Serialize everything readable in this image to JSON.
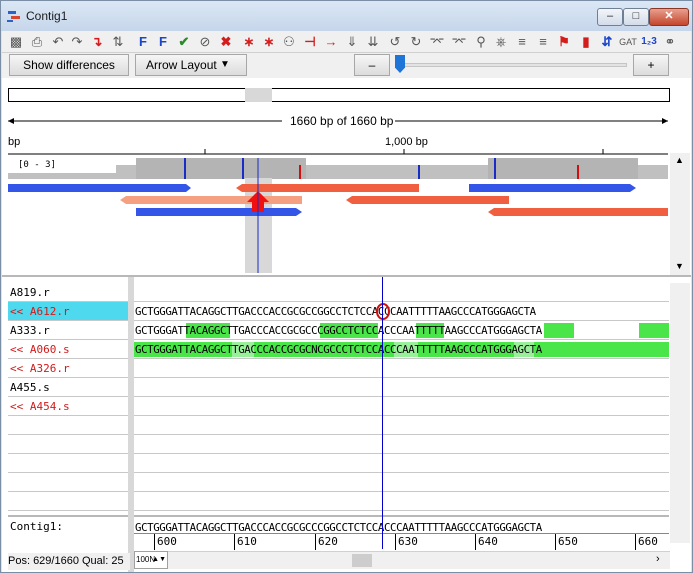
{
  "window": {
    "title": "Contig1",
    "minimize": "–",
    "maximize": "□",
    "close": "✕"
  },
  "toolbar": {
    "icons": [
      "save-icon",
      "print-icon",
      "undo-icon",
      "redo-icon",
      "tools-icon",
      "swap-icon",
      "find-forward-icon",
      "find-reverse-icon",
      "accept-icon",
      "reject-icon",
      "delete-marks-icon",
      "next-mark-icon",
      "prev-mark-icon",
      "binoculars-icon",
      "cut-icon",
      "arrow-icon",
      "down-icon",
      "down2-icon",
      "curve-left-icon",
      "curve-right-icon",
      "hat-icon",
      "hat2-icon",
      "zoom-icon",
      "tree-icon",
      "lines-icon",
      "lines2-icon",
      "flag-icon",
      "chromatogram-icon",
      "exchange-icon",
      "gat-icon",
      "number-icon",
      "link-icon"
    ]
  },
  "controls": {
    "show_differences": "Show differences",
    "arrow_layout": "Arrow Layout",
    "dropdown_glyph": "▼",
    "minus": "–",
    "plus": "+",
    "slider_fraction": 0.0
  },
  "overview": {
    "span_label": "1660 bp of 1660 bp",
    "left_tick": "bp",
    "mid_tick": "1,000 bp",
    "depth_label": "[0 - 3]",
    "colors": {
      "forward": "#3355e8",
      "reverse": "#f06040",
      "reverse_light": "#f5a080",
      "coverage": "#c0c0c0",
      "marker": "#f01010",
      "scroll_marker": "#d8d8d8"
    }
  },
  "grid": {
    "rows": [
      {
        "name": "A819.r",
        "sequence": "",
        "reverse": false,
        "selected": false
      },
      {
        "name": "<< A612.r",
        "sequence": "GCTGGGATTACAGGCTTGACCCACCGCGCCGGCCTCTCCACCCAATTTTTAAGCCCATGGGAGCTA",
        "reverse": true,
        "selected": true
      },
      {
        "name": "A333.r",
        "sequence": "GCTGGGATTACAGGCTTGACCCACCGCGCCCGGCCTCTCCACCCAATTTTTAAGCCCATGGGAGCTA",
        "reverse": false,
        "selected": false
      },
      {
        "name": "<< A060.s",
        "sequence": "GCTGGGATTACAGGCTTGACCCACCGCGCNCGCCCTCTCCACCCAATTTTTAAGCCCATGGGAGCTA",
        "reverse": true,
        "selected": false
      },
      {
        "name": "<< A326.r",
        "sequence": "",
        "reverse": true,
        "selected": false
      },
      {
        "name": "A455.s",
        "sequence": "",
        "reverse": false,
        "selected": false
      },
      {
        "name": "<< A454.s",
        "sequence": "",
        "reverse": true,
        "selected": false
      },
      {
        "name": "",
        "sequence": "",
        "reverse": false,
        "selected": false
      },
      {
        "name": "",
        "sequence": "",
        "reverse": false,
        "selected": false
      },
      {
        "name": "",
        "sequence": "",
        "reverse": false,
        "selected": false
      },
      {
        "name": "",
        "sequence": "",
        "reverse": false,
        "selected": false
      },
      {
        "name": "",
        "sequence": "",
        "reverse": false,
        "selected": false
      }
    ],
    "consensus_label": "Contig1:",
    "consensus_sequence": "GCTGGGATTACAGGCTTGACCCACCGCGCCCGGCCTCTCCACCCAATTTTTAAGCCCATGGGAGCTA",
    "ruler": [
      "600",
      "610",
      "620",
      "630",
      "640",
      "650",
      "660"
    ]
  },
  "status": {
    "position": "Pos: 629/1660  Qual: 25",
    "zoom": "100N"
  }
}
